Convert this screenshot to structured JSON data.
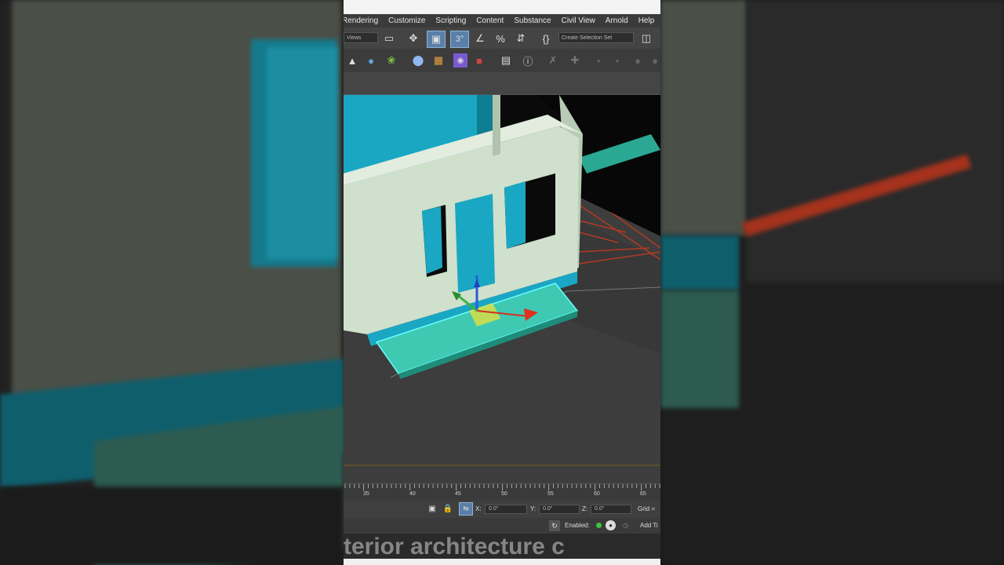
{
  "menubar": {
    "items": [
      "Rendering",
      "Customize",
      "Scripting",
      "Content",
      "Substance",
      "Civil View",
      "Arnold",
      "Help"
    ]
  },
  "toolbar": {
    "dropdown_left": "Views",
    "selection_set": "Create Selection Set"
  },
  "timeline": {
    "ticks": [
      "35",
      "40",
      "45",
      "50",
      "55",
      "60",
      "65"
    ]
  },
  "status": {
    "x_label": "X:",
    "x_value": "0.0\"",
    "y_label": "Y:",
    "y_value": "0.0\"",
    "z_label": "Z:",
    "z_value": "0.0\"",
    "grid_label": "Grid =",
    "enabled_label": "Enabled:",
    "add_label": "Add Ti"
  },
  "caption": {
    "text": "terior architecture c"
  },
  "colors": {
    "accent": "#1aa7c4",
    "wall": "#cfe0cc",
    "step": "#3fc9b3",
    "active_tool": "#5a7fa8"
  },
  "icons": [
    "move-icon",
    "select-icon",
    "snap-icon",
    "angle-snap-icon",
    "percent-snap-icon",
    "spinner-snap-icon",
    "curly-braces-icon",
    "render-icon",
    "material-icon",
    "lock-icon"
  ]
}
